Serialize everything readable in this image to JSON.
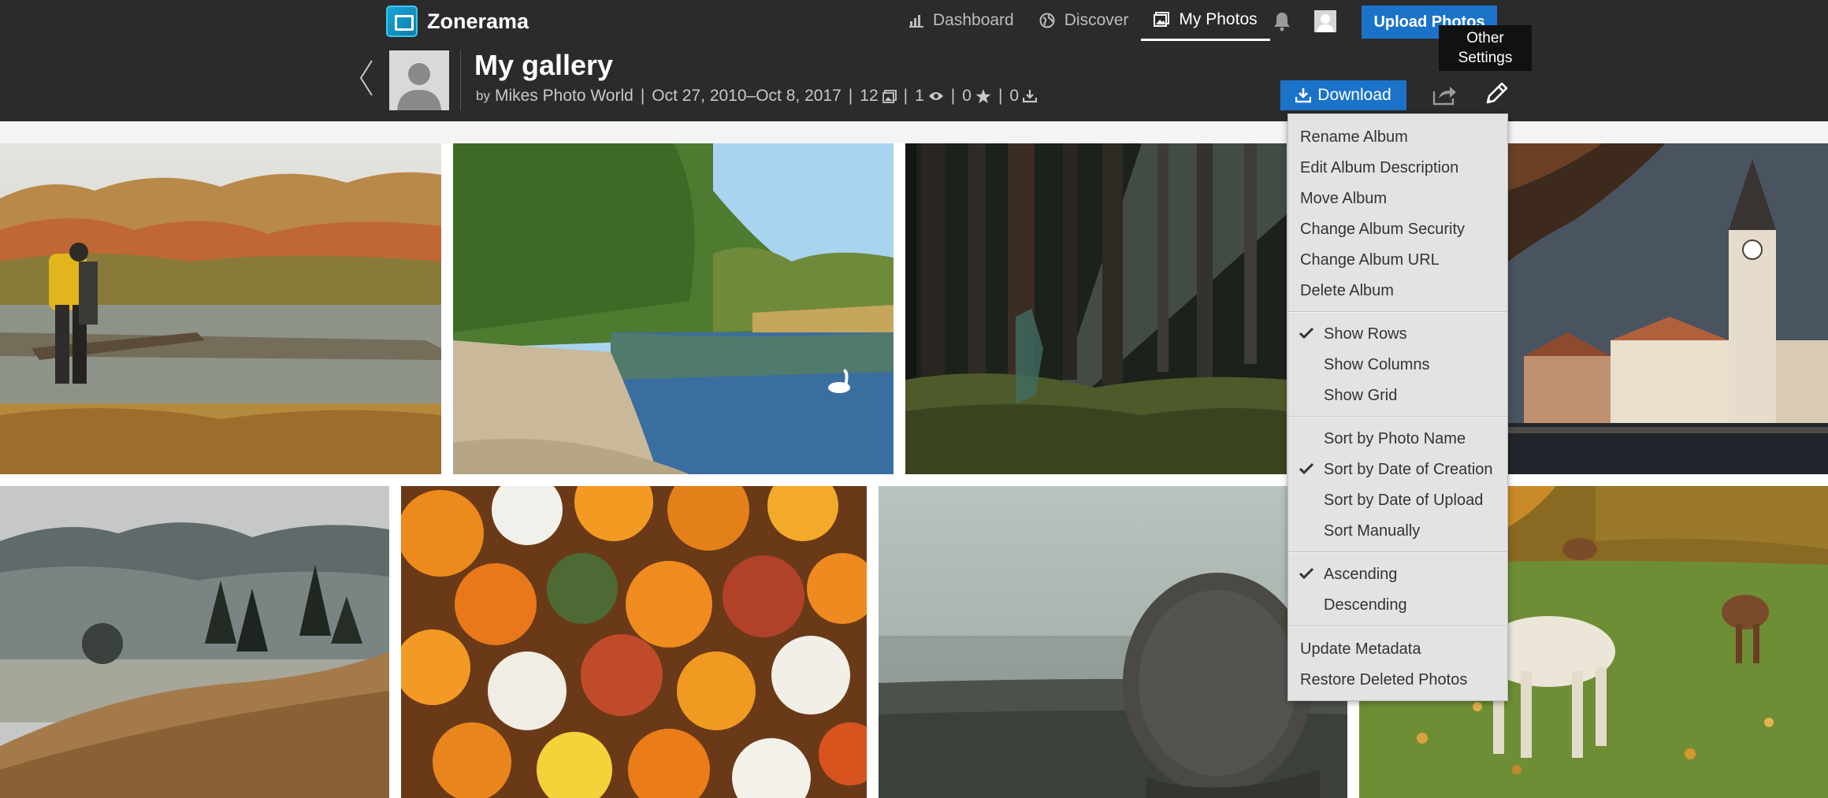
{
  "app": {
    "logo_text": "Zonerama"
  },
  "nav": {
    "items": [
      {
        "label": "Dashboard",
        "icon": "chart-icon"
      },
      {
        "label": "Discover",
        "icon": "globe-icon"
      },
      {
        "label": "My Photos",
        "icon": "photos-icon",
        "active": true
      }
    ],
    "upload_label": "Upload Photos",
    "notifications_icon": "bell-icon",
    "user_icon": "avatar"
  },
  "tooltip": {
    "line1": "Other",
    "line2": "Settings"
  },
  "album": {
    "title": "My gallery",
    "by": "by",
    "owner": "Mikes Photo World",
    "date_range": "Oct 27, 2010–Oct 8, 2017",
    "photos_count": "12",
    "views_count": "1",
    "stars_count": "0",
    "downloads_count": "0",
    "separator": "|"
  },
  "actions": {
    "download_label": "Download"
  },
  "menu": {
    "album_actions": [
      "Rename Album",
      "Edit Album Description",
      "Move Album",
      "Change Album Security",
      "Change Album URL",
      "Delete Album"
    ],
    "view_options": [
      {
        "label": "Show Rows",
        "checked": true
      },
      {
        "label": "Show Columns",
        "checked": false
      },
      {
        "label": "Show Grid",
        "checked": false
      }
    ],
    "sort_options": [
      {
        "label": "Sort by Photo Name",
        "checked": false
      },
      {
        "label": "Sort by Date of Creation",
        "checked": true
      },
      {
        "label": "Sort by Date of Upload",
        "checked": false
      },
      {
        "label": "Sort Manually",
        "checked": false
      }
    ],
    "order_options": [
      {
        "label": "Ascending",
        "checked": true
      },
      {
        "label": "Descending",
        "checked": false
      }
    ],
    "maintenance": [
      "Update Metadata",
      "Restore Deleted Photos"
    ]
  },
  "photos": [
    {
      "subject": "hiker-by-autumn-lake"
    },
    {
      "subject": "river-beach-with-swan"
    },
    {
      "subject": "dark-forest-sunbeams"
    },
    {
      "subject": "prague-water-tower"
    },
    {
      "subject": "misty-mountain-meadow"
    },
    {
      "subject": "pumpkins-and-gourds"
    },
    {
      "subject": "hay-bale-in-fog"
    },
    {
      "subject": "white-deer-in-park"
    }
  ],
  "colors": {
    "header_bg": "#2b2b2b",
    "accent": "#1b73c9",
    "menu_bg": "#e3e3e3"
  }
}
